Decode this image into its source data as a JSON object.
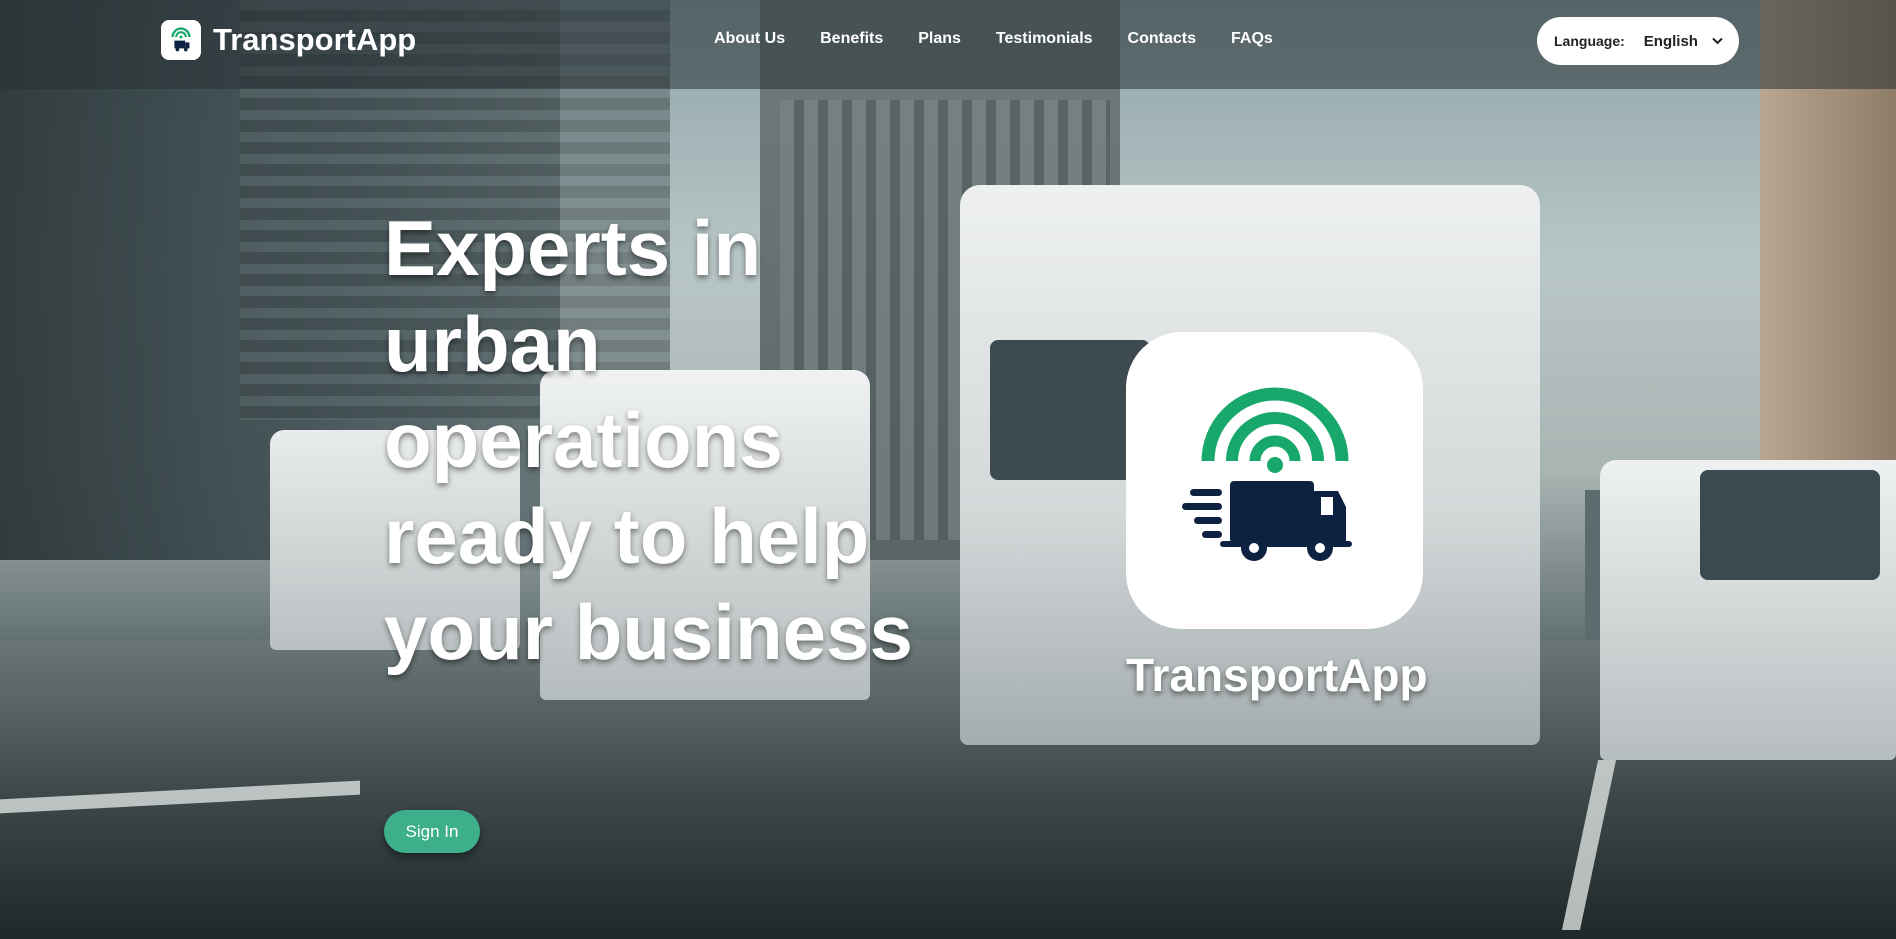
{
  "header": {
    "brand_name": "TransportApp",
    "nav": [
      {
        "label": "About Us"
      },
      {
        "label": "Benefits"
      },
      {
        "label": "Plans"
      },
      {
        "label": "Testimonials"
      },
      {
        "label": "Contacts"
      },
      {
        "label": "FAQs"
      }
    ],
    "language": {
      "label": "Language:",
      "value": "English"
    }
  },
  "hero": {
    "headline": "Experts in urban operations ready to help your business",
    "signin_label": "Sign In",
    "app_name": "TransportApp"
  },
  "icons": {
    "brand_logo": "truck-signal-icon",
    "card_logo": "truck-signal-icon",
    "language_chevron": "chevron-down-icon"
  },
  "colors": {
    "accent_green": "#3daf8a",
    "logo_green": "#19a86b",
    "truck_navy": "#0d2240"
  }
}
